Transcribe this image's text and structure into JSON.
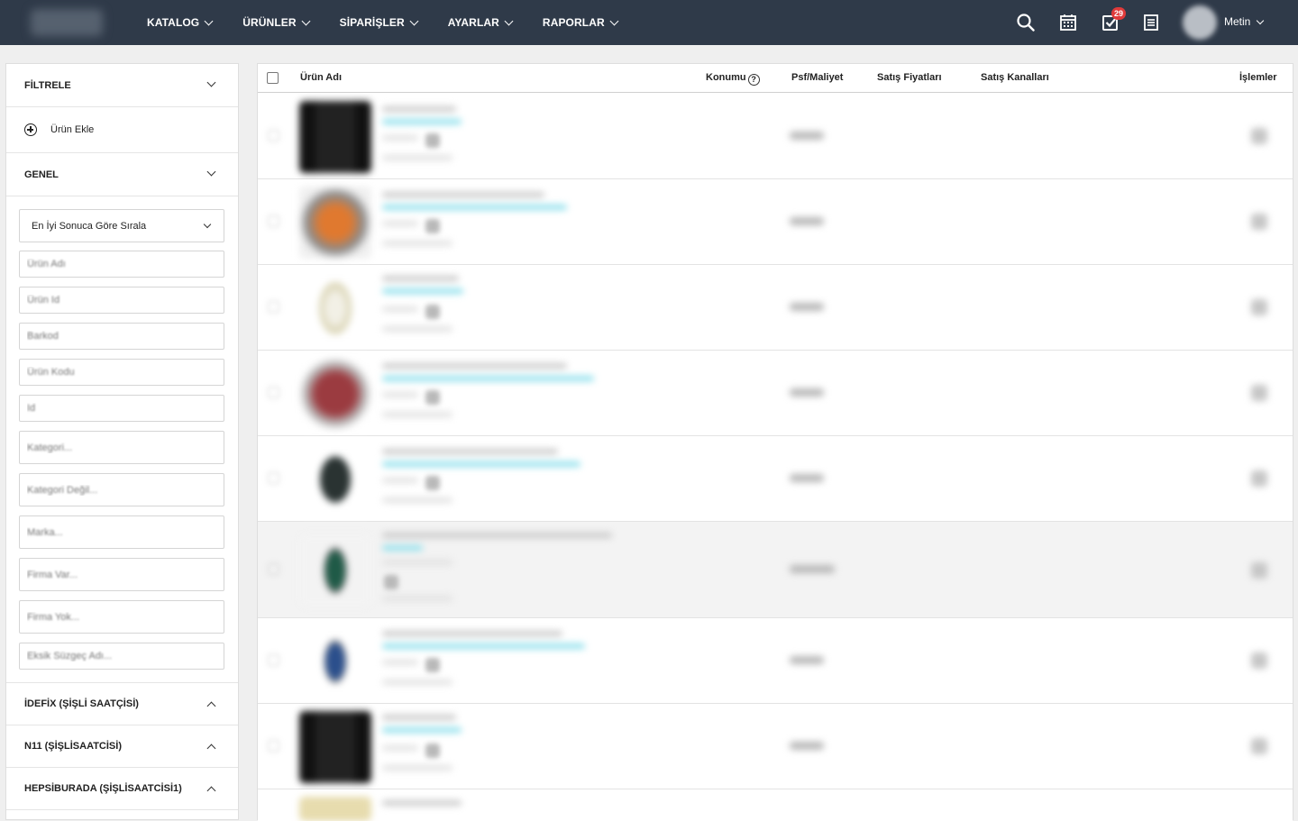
{
  "nav": {
    "items": [
      "KATALOG",
      "ÜRÜNLER",
      "SİPARİŞLER",
      "AYARLAR",
      "RAPORLAR"
    ],
    "tasks_badge": "29",
    "user_name": "Metin"
  },
  "sidebar": {
    "filter_label": "FİLTRELE",
    "add_product_label": "Ürün Ekle",
    "general_label": "GENEL",
    "sort_selected": "En İyi Sonuca Göre Sırala",
    "fields": {
      "product_name": "Ürün Adı",
      "product_id": "Ürün Id",
      "barcode": "Barkod",
      "product_code": "Ürün Kodu",
      "short": "Id",
      "category": "Kategori...",
      "category_not": "Kategori Değil...",
      "brand": "Marka...",
      "has_company": "Firma Var...",
      "no_company": "Firma Yok...",
      "missing_filter": "Eksik Süzgeç Adı..."
    },
    "sections": [
      "İDEFİX (ŞİŞLİ SAATÇİSİ)",
      "N11 (ŞİŞLİSAATCİSİ)",
      "HEPSİBURADA (ŞİŞLİSAATCİSİ1)"
    ]
  },
  "table": {
    "columns": {
      "name": "Ürün Adı",
      "position": "Konumu",
      "psf": "Psf/Maliyet",
      "sale_prices": "Satış Fiyatları",
      "sale_channels": "Satış Kanalları",
      "actions": "İşlemler"
    }
  }
}
